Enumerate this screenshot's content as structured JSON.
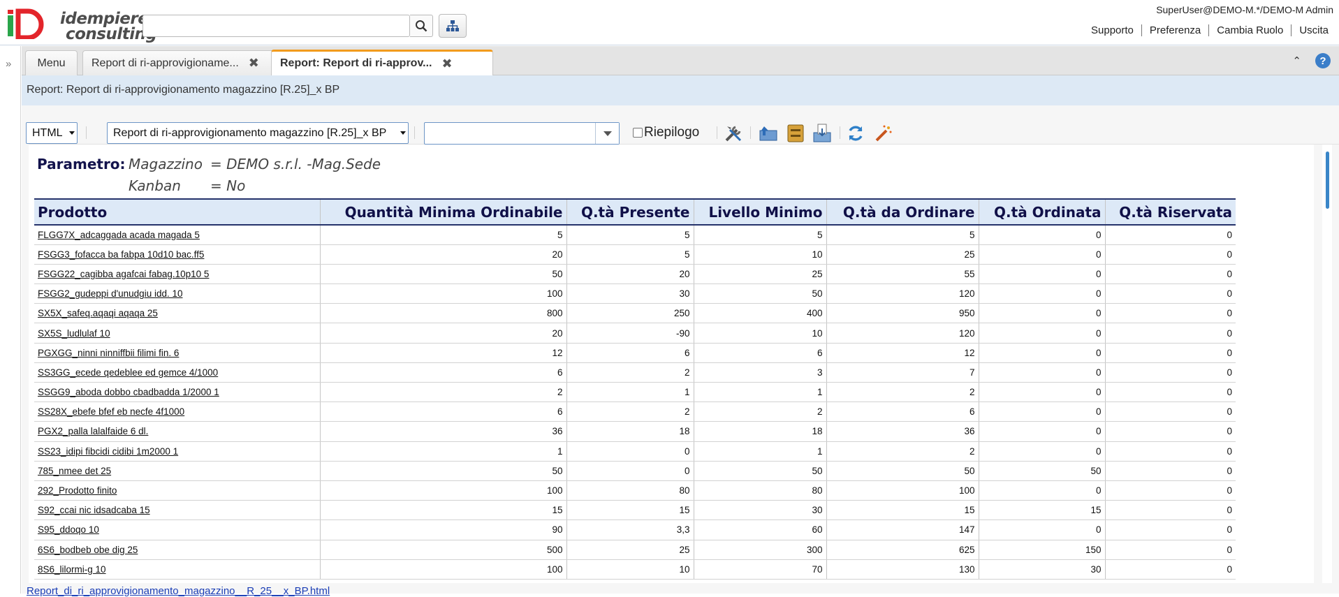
{
  "header": {
    "logo": {
      "line1": "idempiere",
      "line2": "consulting"
    },
    "search_placeholder": "",
    "user": "SuperUser@DEMO-M.*/DEMO-M Admin",
    "links": [
      "Supporto",
      "Preferenza",
      "Cambia Ruolo",
      "Uscita"
    ]
  },
  "tabs": [
    {
      "label": "Menu"
    },
    {
      "label": "Report di ri-approvigioname...",
      "close": "✖"
    },
    {
      "label": "Report: Report di ri-approv...",
      "close": "✖"
    }
  ],
  "breadcrumb": "Report: Report di ri-approvigionamento magazzino [R.25]_x BP",
  "toolbar": {
    "format": "HTML",
    "report": "Report di ri-approvigionamento magazzino [R.25]_x BP",
    "combo_value": "",
    "summary_label": "Riepilogo"
  },
  "params": {
    "label": "Parametro:",
    "rows": [
      {
        "name": "Magazzino",
        "value": "= DEMO s.r.l. -Mag.Sede"
      },
      {
        "name": "Kanban",
        "value": "= No"
      }
    ]
  },
  "table": {
    "columns": [
      "Prodotto",
      "Quantità Minima Ordinabile",
      "Q.tà Presente",
      "Livello Minimo",
      "Q.tà da Ordinare",
      "Q.tà Ordinata",
      "Q.tà Riservata"
    ],
    "rows": [
      [
        "FLGG7X_adcaggada acada magada 5",
        "5",
        "5",
        "5",
        "5",
        "0",
        "0"
      ],
      [
        "FSGG3_fofacca ba fabpa 10d10 bac.ff5",
        "20",
        "5",
        "10",
        "25",
        "0",
        "0"
      ],
      [
        "FSGG22_cagibba agafcai fabag.10p10 5",
        "50",
        "20",
        "25",
        "55",
        "0",
        "0"
      ],
      [
        "FSGG2_gudeppi d'unudgiu idd. 10",
        "100",
        "30",
        "50",
        "120",
        "0",
        "0"
      ],
      [
        "SX5X_safeq.aqaqi aqaqa 25",
        "800",
        "250",
        "400",
        "950",
        "0",
        "0"
      ],
      [
        "SX5S_ludlulaf 10",
        "20",
        "-90",
        "10",
        "120",
        "0",
        "0"
      ],
      [
        "PGXGG_ninni ninniffbii filimi fin. 6",
        "12",
        "6",
        "6",
        "12",
        "0",
        "0"
      ],
      [
        "SS3GG_ecede qedeblee ed gemce 4/1000",
        "6",
        "2",
        "3",
        "7",
        "0",
        "0"
      ],
      [
        "SSGG9_aboda dobbo cbadbadda 1/2000 1",
        "2",
        "1",
        "1",
        "2",
        "0",
        "0"
      ],
      [
        "SS28X_ebefe bfef eb necfe 4f1000",
        "6",
        "2",
        "2",
        "6",
        "0",
        "0"
      ],
      [
        "PGX2_palla lalalfaide 6 dl.",
        "36",
        "18",
        "18",
        "36",
        "0",
        "0"
      ],
      [
        "SS23_idipi fibcidi cidibi 1m2000 1",
        "1",
        "0",
        "1",
        "2",
        "0",
        "0"
      ],
      [
        "785_nmee det 25",
        "50",
        "0",
        "50",
        "50",
        "50",
        "0"
      ],
      [
        "292_Prodotto finito",
        "100",
        "80",
        "80",
        "100",
        "0",
        "0"
      ],
      [
        "S92_ccai nic idsadcaba 15",
        "15",
        "15",
        "30",
        "15",
        "15",
        "0"
      ],
      [
        "S95_ddoqo 10",
        "90",
        "3,3",
        "60",
        "147",
        "0",
        "0"
      ],
      [
        "6S6_bodbeb obe dig 25",
        "500",
        "25",
        "300",
        "625",
        "150",
        "0"
      ],
      [
        "8S6_lilormi-g 10",
        "100",
        "10",
        "70",
        "130",
        "30",
        "0"
      ]
    ]
  },
  "footer_link": "Report_di_ri_approvigionamento_magazzino__R_25__x_BP.html"
}
